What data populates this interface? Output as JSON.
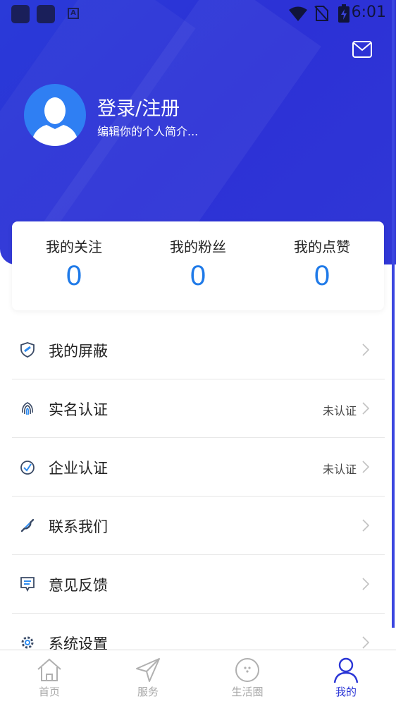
{
  "status_bar": {
    "time": "6:01"
  },
  "profile": {
    "name": "登录/注册",
    "bio": "编辑你的个人简介..."
  },
  "stats": [
    {
      "label": "我的关注",
      "value": "0"
    },
    {
      "label": "我的粉丝",
      "value": "0"
    },
    {
      "label": "我的点赞",
      "value": "0"
    }
  ],
  "menu": [
    {
      "label": "我的屏蔽",
      "status": "",
      "icon": "shield-icon"
    },
    {
      "label": "实名认证",
      "status": "未认证",
      "icon": "fingerprint-icon"
    },
    {
      "label": "企业认证",
      "status": "未认证",
      "icon": "badge-check-icon"
    },
    {
      "label": "联系我们",
      "status": "",
      "icon": "phone-icon"
    },
    {
      "label": "意见反馈",
      "status": "",
      "icon": "feedback-icon"
    },
    {
      "label": "系统设置",
      "status": "",
      "icon": "gear-icon"
    }
  ],
  "bottom_nav": [
    {
      "label": "首页",
      "icon": "home-icon",
      "active": false
    },
    {
      "label": "服务",
      "icon": "send-icon",
      "active": false
    },
    {
      "label": "生活圈",
      "icon": "circle-face-icon",
      "active": false
    },
    {
      "label": "我的",
      "icon": "person-icon",
      "active": true
    }
  ],
  "colors": {
    "hero_blue": "#2c31d6",
    "stat_blue": "#1f7ae8",
    "active_nav": "#2a35d6",
    "inactive_nav": "#a8a8a8"
  }
}
